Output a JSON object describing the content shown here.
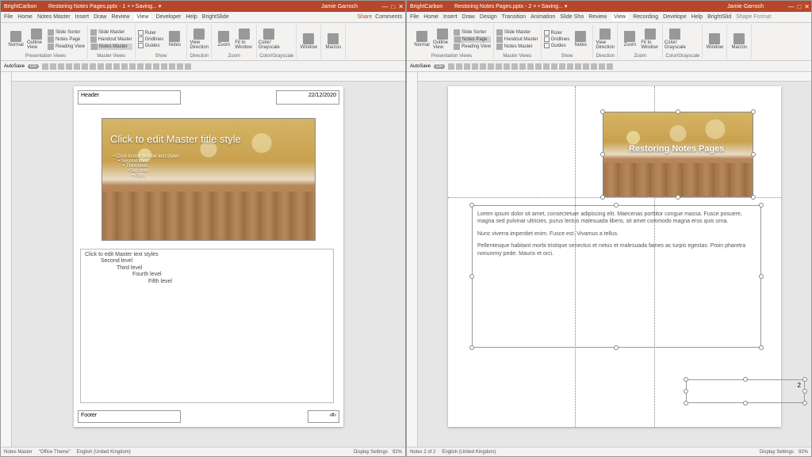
{
  "titlebar": {
    "app": "BrightCarbon",
    "doc": "Restoring Notes Pages.pptx",
    "saving": "Saving... ▾",
    "user": "Jamie Garroch",
    "inst1": "- 1 ×",
    "inst2": "- 2 ×"
  },
  "menus_left": [
    "File",
    "Home",
    "Notes Master",
    "Insert",
    "Draw",
    "Review",
    "View",
    "Developer",
    "Help",
    "BrightSlide"
  ],
  "menus_right": [
    "File",
    "Home",
    "Insert",
    "Draw",
    "Design",
    "Transition",
    "Animation",
    "Slide Sho",
    "Review",
    "View",
    "Recording",
    "Develope",
    "Help",
    "BrightSlid",
    "Shape Format"
  ],
  "share": "Share",
  "comments": "Comments",
  "ribbon": {
    "presentation_views": {
      "label": "Presentation Views",
      "normal": "Normal",
      "outline": "Outline View",
      "slide_sorter": "Slide Sorter",
      "notes_page": "Notes Page",
      "reading": "Reading View"
    },
    "master_views": {
      "label": "Master Views",
      "slide": "Slide Master",
      "handout": "Handout Master",
      "notes": "Notes Master"
    },
    "show": {
      "label": "Show",
      "ruler": "Ruler",
      "grid": "Gridlines",
      "guides": "Guides",
      "notes": "Notes"
    },
    "zoom": {
      "label": "Zoom",
      "zoom": "Zoom",
      "fit": "Fit to Window"
    },
    "direction": {
      "label": "Direction",
      "view": "View Direction"
    },
    "color": {
      "label": "Color/Grayscale",
      "color": "Color/ Grayscale"
    },
    "window": {
      "label": "Window"
    },
    "macros": {
      "label": "Macros"
    }
  },
  "qat": {
    "autosave": "AutoSave",
    "on": "On"
  },
  "left": {
    "header": "Header",
    "date": "22/12/2020",
    "master_title": "Click to edit Master title style",
    "bullets": [
      "• Click to edit Master text styles",
      "• Second level",
      "• Third level",
      "• Sec tem",
      "• Fifth"
    ],
    "notes_levels": [
      "Click to edit Master text styles",
      "Second level",
      "Third level",
      "Fourth level",
      "Fifth level"
    ],
    "footer": "Footer",
    "pagenum": "‹#›"
  },
  "right": {
    "slide_title": "Restoring Notes Pages",
    "notes_p1": "Lorem ipsum dolor sit amet, consectetuer adipiscing elit. Maecenas porttitor congue massa. Fusce posuere, magna sed pulvinar ultricies, purus lectus malesuada libero, sit amet commodo magna eros quis urna.",
    "notes_p2": "Nunc viverra imperdiet enim. Fusce est. Vivamus a tellus.",
    "notes_p3": "Pellentesque habitant morbi tristique senectus et netus et malesuada fames ac turpis egestas. Proin pharetra nonummy pede. Mauris et orci.",
    "pagenum": "2"
  },
  "status_left": {
    "view": "Notes Master",
    "theme": "\"Office Theme\"",
    "lang": "English (United Kingdom)",
    "display": "Display Settings",
    "zoom": "92%"
  },
  "status_right": {
    "view": "Notes 2 of 2",
    "lang": "English (United Kingdom)",
    "display": "Display Settings",
    "zoom": "92%"
  }
}
